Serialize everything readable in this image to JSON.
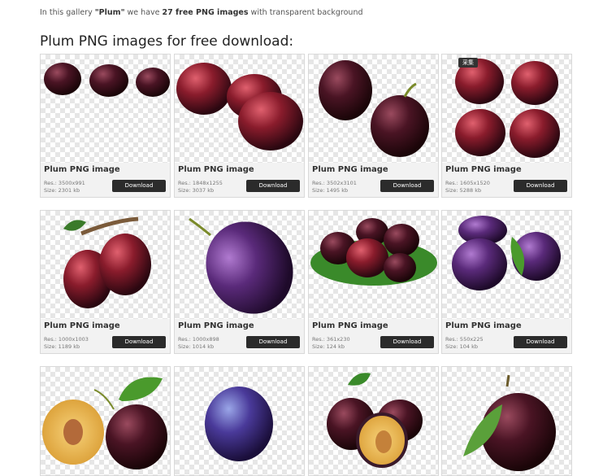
{
  "intro": {
    "prefix": "In this gallery ",
    "gallery_name": "\"Plum\"",
    "middle": " we have ",
    "count_text": "27 free PNG images",
    "suffix": " with transparent background"
  },
  "heading": "Plum PNG images for free download:",
  "download_label": "Download",
  "cards": [
    {
      "title": "Plum PNG image",
      "res": "Res.: 3500x991",
      "size": "Size: 2301 kb",
      "icon": "three-plums-row-image"
    },
    {
      "title": "Plum PNG image",
      "res": "Res.: 1848x1255",
      "size": "Size: 3037 kb",
      "icon": "plum-cluster-image"
    },
    {
      "title": "Plum PNG image",
      "res": "Res.: 3502x3101",
      "size": "Size: 1495 kb",
      "icon": "two-dark-plums-image"
    },
    {
      "title": "Plum PNG image",
      "res": "Res.: 1605x1520",
      "size": "Size: 5288 kb",
      "icon": "four-plums-grid-image",
      "tag": "采集"
    },
    {
      "title": "Plum PNG image",
      "res": "Res.: 1000x1003",
      "size": "Size: 1189 kb",
      "icon": "plums-on-branch-image"
    },
    {
      "title": "Plum PNG image",
      "res": "Res.: 1000x898",
      "size": "Size: 1014 kb",
      "icon": "single-oval-plum-image"
    },
    {
      "title": "Plum PNG image",
      "res": "Res.: 361x230",
      "size": "Size: 124 kb",
      "icon": "plum-pile-on-leaves-image"
    },
    {
      "title": "Plum PNG image",
      "res": "Res.: 550x225",
      "size": "Size: 104 kb",
      "icon": "purple-plums-with-leaf-image"
    },
    {
      "title": "",
      "res": "",
      "size": "",
      "icon": "sliced-plum-image"
    },
    {
      "title": "",
      "res": "",
      "size": "",
      "icon": "blue-plum-image"
    },
    {
      "title": "",
      "res": "",
      "size": "",
      "icon": "halved-plum-with-leaf-image"
    },
    {
      "title": "",
      "res": "",
      "size": "",
      "icon": "plum-with-leaf-image"
    }
  ],
  "colors": {
    "plum_dark": "#3a0f1e",
    "plum_red": "#8a1c2c",
    "plum_purple": "#4a2a6a",
    "leaf_green": "#4a8a2c",
    "button_bg": "#2b2b2b"
  }
}
